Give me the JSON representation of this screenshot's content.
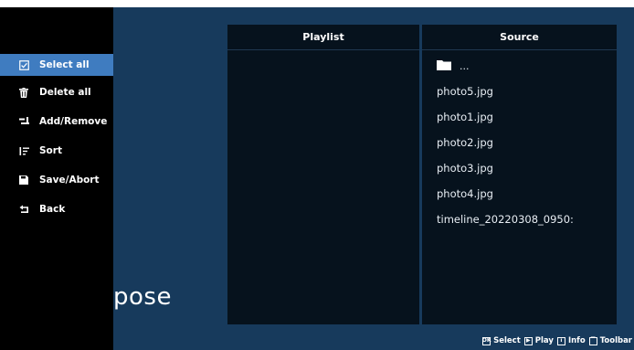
{
  "menu": {
    "items": [
      {
        "label": "Select all",
        "icon": "checkbox-icon",
        "selected": true
      },
      {
        "label": "Delete all",
        "icon": "trash-icon",
        "selected": false
      },
      {
        "label": "Add/Remove",
        "icon": "add-remove-icon",
        "selected": false
      },
      {
        "label": "Sort",
        "icon": "sort-icon",
        "selected": false
      },
      {
        "label": "Save/Abort",
        "icon": "save-icon",
        "selected": false
      },
      {
        "label": "Back",
        "icon": "back-icon",
        "selected": false
      }
    ]
  },
  "background_text": "pose",
  "playlist": {
    "header": "Playlist"
  },
  "source": {
    "header": "Source",
    "folder_label": "...",
    "files": [
      "photo5.jpg",
      "photo1.jpg",
      "photo2.jpg",
      "photo3.jpg",
      "photo4.jpg",
      "timeline_20220308_0950:"
    ]
  },
  "hints": [
    {
      "icon": "ok-key-icon",
      "label": "Select"
    },
    {
      "icon": "play-key-icon",
      "label": "Play"
    },
    {
      "icon": "info-key-icon",
      "label": "Info"
    },
    {
      "icon": "toolbar-key-icon",
      "label": "Toolbar"
    }
  ],
  "colors": {
    "screen_bg": "#173a5c",
    "menu_bg": "#000000",
    "menu_selected": "#3f7cc0",
    "panel_bg": "#06121d"
  }
}
